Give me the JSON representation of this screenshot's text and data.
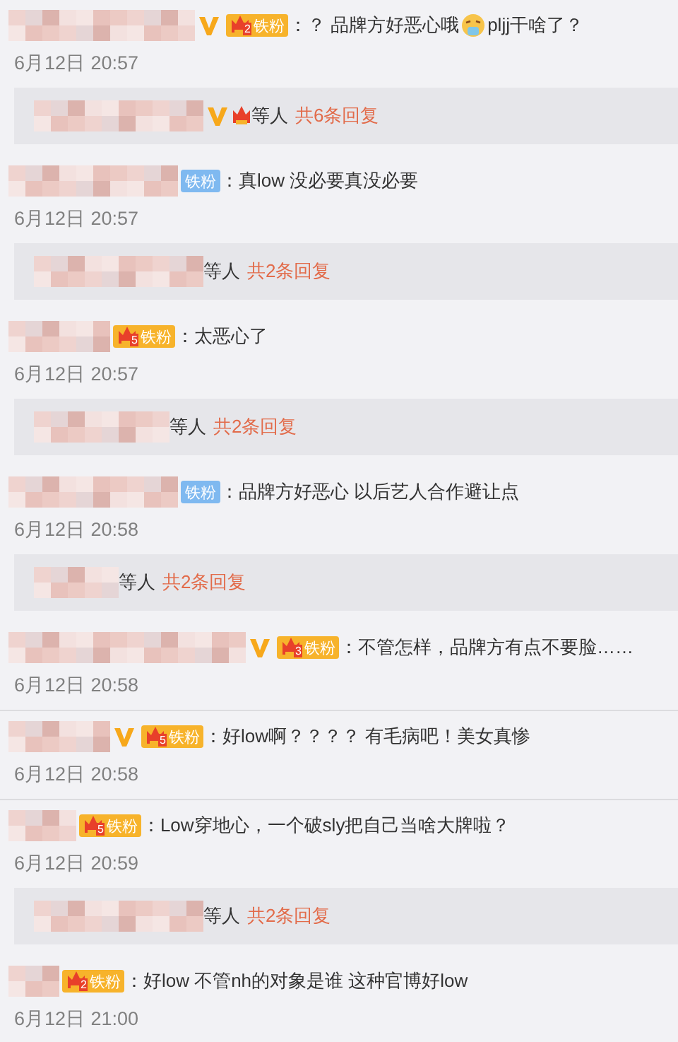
{
  "comments": [
    {
      "verified": true,
      "badge": {
        "kind": "crown",
        "label": "铁粉",
        "level": "2"
      },
      "parts": [
        {
          "kind": "text",
          "text": "：？ 品牌方好恶心哦"
        },
        {
          "kind": "emoji"
        },
        {
          "kind": "text",
          "text": "pljj干啥了？"
        }
      ],
      "time": "6月12日 20:57",
      "replies": {
        "verified": true,
        "crown": true,
        "suffix": "等人",
        "count": "共6条回复"
      }
    },
    {
      "verified": false,
      "badge": {
        "kind": "plain",
        "label": "铁粉"
      },
      "parts": [
        {
          "kind": "text",
          "text": "：真low 没必要真没必要"
        }
      ],
      "time": "6月12日 20:57",
      "replies": {
        "verified": false,
        "crown": false,
        "suffix": "等人",
        "count": "共2条回复"
      }
    },
    {
      "verified": false,
      "badge": {
        "kind": "crown",
        "label": "铁粉",
        "level": "5"
      },
      "parts": [
        {
          "kind": "text",
          "text": "：太恶心了"
        }
      ],
      "time": "6月12日 20:57",
      "replies": {
        "verified": false,
        "crown": false,
        "suffix": "等人",
        "count": "共2条回复"
      }
    },
    {
      "verified": false,
      "badge": {
        "kind": "plain",
        "label": "铁粉"
      },
      "parts": [
        {
          "kind": "text",
          "text": "：品牌方好恶心 以后艺人合作避让点"
        }
      ],
      "time": "6月12日 20:58",
      "replies": {
        "verified": false,
        "crown": false,
        "suffix": "等人",
        "count": "共2条回复"
      }
    },
    {
      "verified": true,
      "badge": {
        "kind": "crown",
        "label": "铁粉",
        "level": "3"
      },
      "parts": [
        {
          "kind": "text",
          "text": "：不管怎样，品牌方有点不要脸……"
        }
      ],
      "time": "6月12日 20:58"
    },
    {
      "verified": true,
      "badge": {
        "kind": "crown",
        "label": "铁粉",
        "level": "5"
      },
      "parts": [
        {
          "kind": "text",
          "text": "：好low啊？？？？ 有毛病吧！美女真惨"
        }
      ],
      "time": "6月12日 20:58"
    },
    {
      "verified": false,
      "badge": {
        "kind": "crown",
        "label": "铁粉",
        "level": "5"
      },
      "parts": [
        {
          "kind": "text",
          "text": "：Low穿地心，一个破sly把自己当啥大牌啦？"
        }
      ],
      "time": "6月12日 20:59",
      "replies": {
        "verified": false,
        "crown": false,
        "suffix": "等人",
        "count": "共2条回复"
      }
    },
    {
      "verified": false,
      "badge": {
        "kind": "crown",
        "label": "铁粉",
        "level": "2"
      },
      "parts": [
        {
          "kind": "text",
          "text": "：好low 不管nh的对象是谁 这种官博好low"
        }
      ],
      "time": "6月12日 21:00"
    }
  ]
}
